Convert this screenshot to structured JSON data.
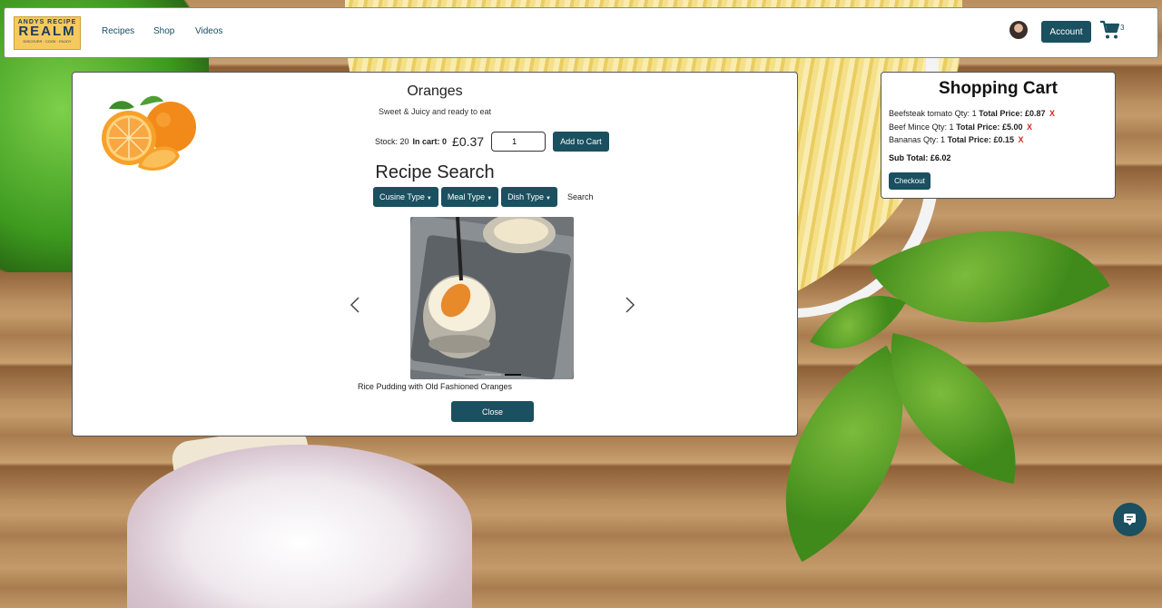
{
  "brand": {
    "line1": "ANDYS RECIPE",
    "line2": "REALM",
    "tagline": "DISCOVER · COOK · ENJOY"
  },
  "nav": {
    "links": [
      "Recipes",
      "Shop",
      "Videos"
    ],
    "account_label": "Account",
    "cart_count": "3"
  },
  "product": {
    "name": "Oranges",
    "description": "Sweet & Juicy and ready to eat",
    "stock_label": "Stock: 20",
    "in_cart_label": "In cart: 0",
    "price": "£0.37",
    "quantity": "1",
    "add_label": "Add to Cart"
  },
  "recipe_search": {
    "title": "Recipe Search",
    "filters": [
      "Cusine Type",
      "Meal Type",
      "Dish Type"
    ],
    "search_label": "Search",
    "carousel_caption": "Rice Pudding with Old Fashioned Oranges",
    "close_label": "Close"
  },
  "cart": {
    "title": "Shopping Cart",
    "items": [
      {
        "name": "Beefsteak tomato",
        "qty": "Qty: 1",
        "total_label": "Total Price:",
        "total": "£0.87",
        "remove": "X"
      },
      {
        "name": "Beef Mince",
        "qty": "Qty: 1",
        "total_label": "Total Price:",
        "total": "£5.00",
        "remove": "X"
      },
      {
        "name": "Bananas",
        "qty": "Qty: 1",
        "total_label": "Total Price:",
        "total": "£0.15",
        "remove": "X"
      }
    ],
    "subtotal": "Sub Total: £6.02",
    "checkout_label": "Checkout"
  },
  "colors": {
    "accent": "#1a5060",
    "remove": "#e02020"
  },
  "icons": [
    "cart-icon",
    "chevron-left-icon",
    "chevron-right-icon",
    "chat-icon",
    "caret-down-icon"
  ]
}
